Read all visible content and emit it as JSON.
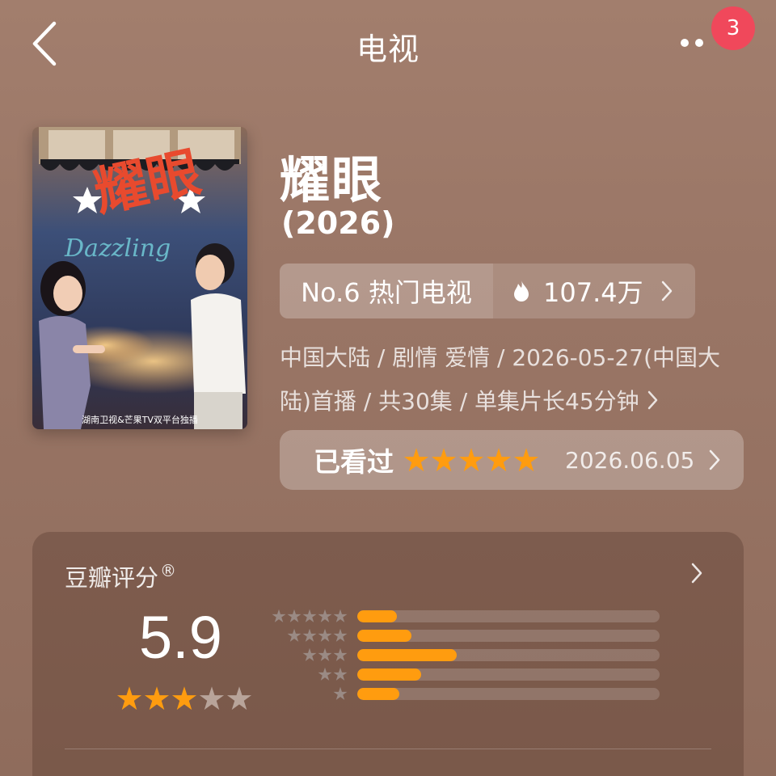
{
  "header": {
    "title": "电视",
    "notification_count": "3",
    "back_icon": "chevron-left-icon",
    "more_icon": "more-dots-icon"
  },
  "poster": {
    "calligraphy": "耀眼",
    "english_title": "Dazzling",
    "broadcast_line": "湖南卫视&芒果TV双平台独播"
  },
  "show": {
    "title": "耀眼",
    "year": "(2026)"
  },
  "ranking": {
    "label": "No.6 热门电视",
    "heat": "107.4万"
  },
  "meta": {
    "line": "中国大陆 / 剧情 爱情 / 2026-05-27(中国大陆)首播 / 共30集 / 单集片长45分钟"
  },
  "watched": {
    "label": "已看过",
    "user_stars": 5,
    "date": "2026.06.05"
  },
  "rating": {
    "title": "豆瓣评分",
    "registered_mark": "®",
    "score": "5.9",
    "score_stars": 3,
    "distribution": [
      {
        "stars": 5,
        "fraction": 0.13
      },
      {
        "stars": 4,
        "fraction": 0.18
      },
      {
        "stars": 3,
        "fraction": 0.33
      },
      {
        "stars": 2,
        "fraction": 0.21
      },
      {
        "stars": 1,
        "fraction": 0.14
      }
    ]
  },
  "colors": {
    "accent_orange": "#ff9c0f",
    "badge_red": "#f0485b",
    "background": "#9a7666",
    "star_empty_small": "#9a8a84",
    "star_empty_large": "#b8a49a"
  }
}
